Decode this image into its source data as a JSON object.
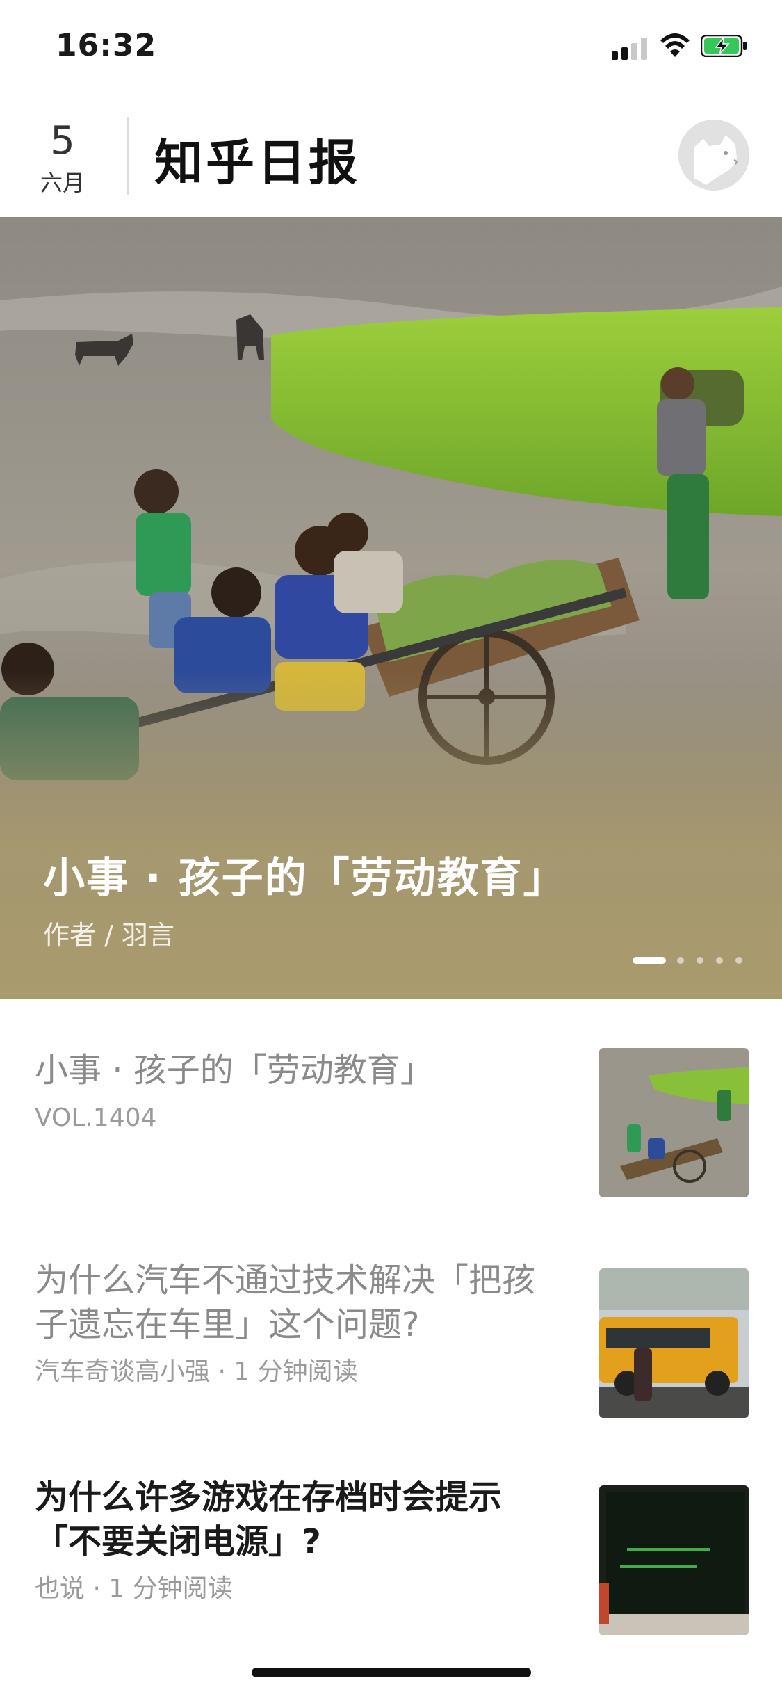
{
  "status_bar": {
    "time": "16:32",
    "icons": [
      "signal-icon",
      "wifi-icon",
      "battery-charging-icon"
    ]
  },
  "header": {
    "date_day": "5",
    "date_month": "六月",
    "title": "知乎日报",
    "avatar_icon": "avatar-dog-icon"
  },
  "hero": {
    "title": "小事 · 孩子的「劳动教育」",
    "author": "作者 / 羽言",
    "carousel_dots": 5,
    "active_dot": 0,
    "tint_color": "#aa9b6e"
  },
  "feed": {
    "items": [
      {
        "title": "小事 · 孩子的「劳动教育」",
        "meta": "VOL.1404",
        "read": true,
        "thumb_icon": "rice-field-children-image"
      },
      {
        "title": "为什么汽车不通过技术解决「把孩子遗忘在车里」这个问题?",
        "meta": "汽车奇谈高小强 · 1 分钟阅读",
        "read": true,
        "thumb_icon": "school-bus-image"
      },
      {
        "title": "为什么许多游戏在存档时会提示「不要关闭电源」?",
        "meta": "也说 · 1 分钟阅读",
        "read": false,
        "thumb_icon": "computer-screen-image"
      }
    ]
  }
}
